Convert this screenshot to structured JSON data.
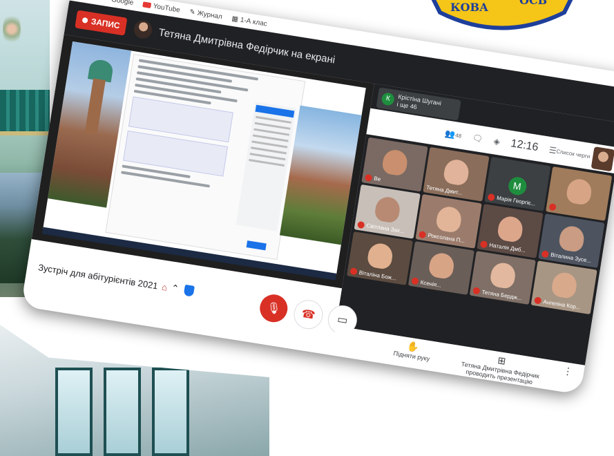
{
  "browser": {
    "bookmarks": [
      {
        "label": "Google",
        "icon": "google-icon"
      },
      {
        "label": "YouTube",
        "icon": "youtube-icon"
      },
      {
        "label": "Журнал",
        "icon": "journal-icon"
      },
      {
        "label": "1-А клас",
        "icon": "class-icon"
      }
    ]
  },
  "topbar": {
    "record_label": "ЗАПИС",
    "presenter_title": "Тетяна Дмитрівна Федірчик на екрані"
  },
  "side_panel": {
    "chip_initial": "К",
    "chip_name": "Крістіна Шугані",
    "chip_more": "і ще 46",
    "people_count": "48",
    "clock": "12:16",
    "captions_label": "Список черги"
  },
  "participants": [
    {
      "name": "Ве",
      "muted": true,
      "bg": "#7a6a63",
      "face": "#c98f6e"
    },
    {
      "name": "Тетяна Дмит...",
      "muted": false,
      "bg": "#8a6d5a",
      "face": "#e1b39a"
    },
    {
      "name": "Марія Георгіє...",
      "muted": true,
      "bg": "#3c4043",
      "face": "",
      "avatar": "М"
    },
    {
      "name": "",
      "muted": true,
      "bg": "#a07c5c",
      "face": "#d7a585"
    },
    {
      "name": "Світлана Зах...",
      "muted": true,
      "bg": "#c8bfb8",
      "face": "#b88a73"
    },
    {
      "name": "Роксолана П...",
      "muted": true,
      "bg": "#9b7c6c",
      "face": "#e2b599"
    },
    {
      "name": "Наталія Дмб...",
      "muted": true,
      "bg": "#5c4a44",
      "face": "#dca68b"
    },
    {
      "name": "Віталина Зусе...",
      "muted": true,
      "bg": "#4d5460",
      "face": "#c99c83"
    },
    {
      "name": "Віталіна Бож...",
      "muted": true,
      "bg": "#5b4b40",
      "face": "#e0b08f"
    },
    {
      "name": "Ксенія...",
      "muted": true,
      "bg": "#6a5e58",
      "face": "#d8a486"
    },
    {
      "name": "Тетяна Бердж...",
      "muted": true,
      "bg": "#7f6f66",
      "face": "#e2b89e"
    },
    {
      "name": "Ангеліна Кор...",
      "muted": true,
      "bg": "#a89684",
      "face": "#d9a98c"
    }
  ],
  "meeting": {
    "name": "Зустріч для абітурієнтів 2021"
  },
  "bottom_right": {
    "raise_hand": "Підняти руку",
    "presenting": "Тетяна Дмитрівна Федірчик проводить презентацію"
  },
  "logo": {
    "text": "КОВА  ОСВ"
  },
  "colors": {
    "record_red": "#d93025",
    "meet_dark": "#202124",
    "accent_blue": "#1a73e8",
    "avatar_green": "#1e8e3e"
  }
}
